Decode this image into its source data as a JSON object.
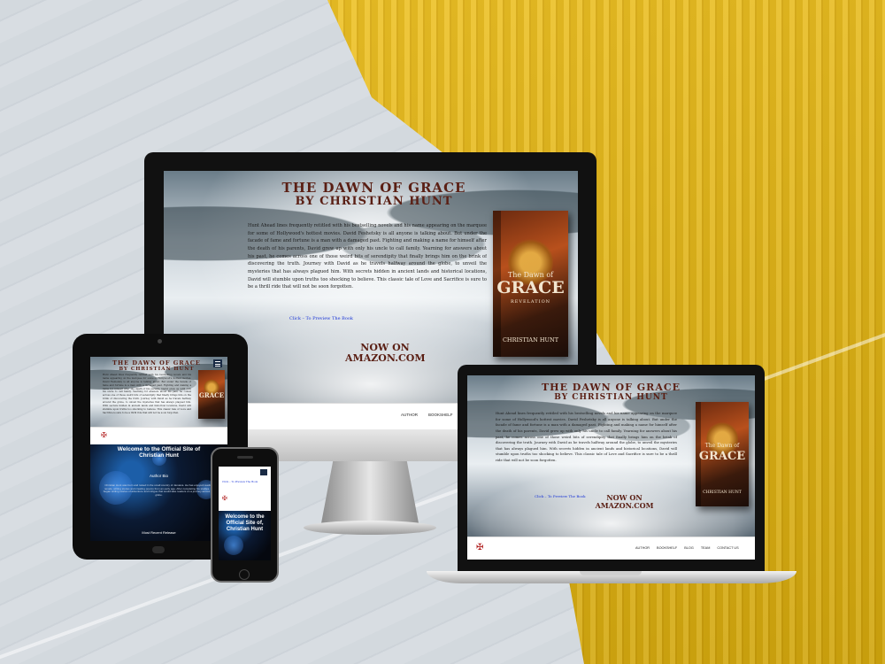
{
  "book": {
    "title_line1": "THE DAWN OF GRACE",
    "title_line2": "BY CHRISTIAN HUNT",
    "cover_title_small": "The Dawn of",
    "cover_title_big": "GRACE",
    "cover_subtitle": "REVELATION",
    "cover_author": "CHRISTIAN HUNT",
    "blurb": "Hunt Ahead lines frequently retitled with his bestselling novels and his name appearing on the marquee for some of Hollywood's hottest movies. David Feshetsky is all anyone is talking about. But under the facade of fame and fortune is a man with a damaged past. Fighting and making a name for himself after the death of his parents, David grew up with only his uncle to call family. Yearning for answers about his past, he comes across one of those weird bits of serendipity that finally brings him on the brink of discovering the truth. Journey with David as he travels halfway around the globe, to unveil the mysteries that has always plagued him. With secrets hidden in ancient lands and historical locations, David will stumble upon truths too shocking to believe. This classic tale of Love and Sacrifice is sure to be a thrill ride that will not be soon forgotten.",
    "preview_link": "Click – To Preview The Book",
    "amazon_line1": "NOW ON",
    "amazon_line2": "AMAZON.COM"
  },
  "nav": {
    "items": [
      "AUTHOR",
      "BOOKSHELF",
      "BLOG",
      "TEAM",
      "CONTACT US"
    ],
    "menu_icon": "hamburger-icon",
    "logo_icon": "cross-logo-icon"
  },
  "welcome": {
    "title": "Welcome to the Official Site of Christian Hunt",
    "phone_title": "Welcome to the Official Site of, Christian Hunt",
    "author_bio": "Author Bio",
    "bio_text": "Christian Hunt was born and raised in the small country of Jamaica. He has enjoyed reading novels, writing stories and creating poems from an early age. After completing his studies, he began writing stories of adventure and intrigue that would take readers on a journey across the globe.",
    "tablet_footer": "Most Recent Release"
  },
  "colors": {
    "title": "#5a1f14",
    "link": "#1a35d6",
    "accent_yellow": "#f2c62a"
  }
}
